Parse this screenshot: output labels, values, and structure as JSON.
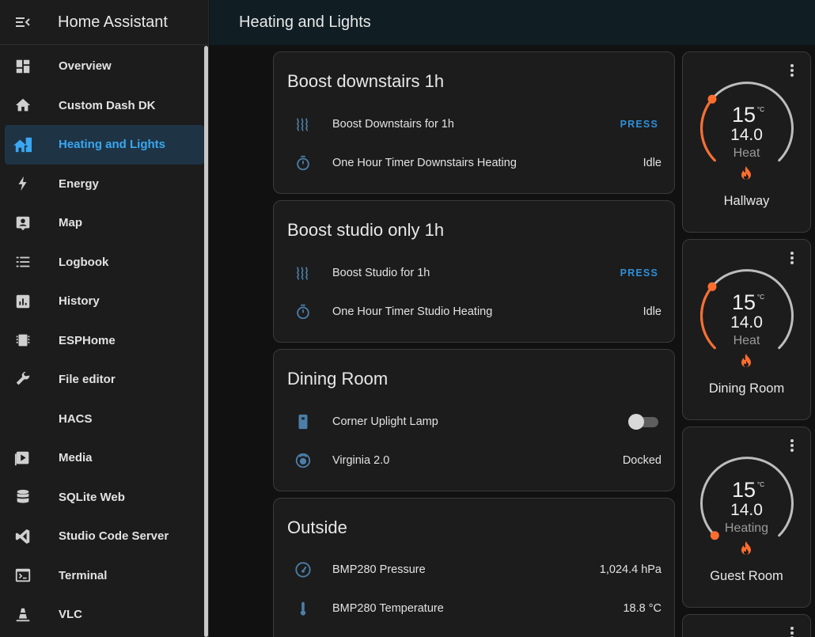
{
  "app": {
    "title": "Home Assistant"
  },
  "page": {
    "title": "Heating and Lights"
  },
  "sidebar": {
    "items": [
      {
        "label": "Overview",
        "icon": "dashboard-icon"
      },
      {
        "label": "Custom Dash DK",
        "icon": "home-icon"
      },
      {
        "label": "Heating and Lights",
        "icon": "home-city-icon"
      },
      {
        "label": "Energy",
        "icon": "lightning-icon"
      },
      {
        "label": "Map",
        "icon": "map-account-icon"
      },
      {
        "label": "Logbook",
        "icon": "list-icon"
      },
      {
        "label": "History",
        "icon": "chart-box-icon"
      },
      {
        "label": "ESPHome",
        "icon": "chip-icon"
      },
      {
        "label": "File editor",
        "icon": "wrench-icon"
      },
      {
        "label": "HACS",
        "icon": ""
      },
      {
        "label": "Media",
        "icon": "play-box-icon"
      },
      {
        "label": "SQLite Web",
        "icon": "database-icon"
      },
      {
        "label": "Studio Code Server",
        "icon": "vscode-icon"
      },
      {
        "label": "Terminal",
        "icon": "console-icon"
      },
      {
        "label": "VLC",
        "icon": "cone-icon"
      }
    ],
    "active_index": 2
  },
  "cards": [
    {
      "title": "Boost downstairs 1h",
      "rows": [
        {
          "name": "Boost Downstairs for 1h",
          "action": "PRESS",
          "icon": "heat-wave-icon"
        },
        {
          "name": "One Hour Timer Downstairs Heating",
          "state": "Idle",
          "icon": "timer-icon"
        }
      ]
    },
    {
      "title": "Boost studio only 1h",
      "rows": [
        {
          "name": "Boost Studio for 1h",
          "action": "PRESS",
          "icon": "heat-wave-icon"
        },
        {
          "name": "One Hour Timer Studio Heating",
          "state": "Idle",
          "icon": "timer-icon"
        }
      ]
    },
    {
      "title": "Dining Room",
      "rows": [
        {
          "name": "Corner Uplight Lamp",
          "toggle_on": false,
          "icon": "light-switch-icon"
        },
        {
          "name": "Virginia 2.0",
          "state": "Docked",
          "icon": "robot-vacuum-icon"
        }
      ]
    },
    {
      "title": "Outside",
      "rows": [
        {
          "name": "BMP280 Pressure",
          "state": "1,024.4 hPa",
          "icon": "gauge-icon"
        },
        {
          "name": "BMP280 Temperature",
          "state": "18.8 °C",
          "icon": "thermometer-icon"
        }
      ]
    }
  ],
  "thermostats": [
    {
      "name": "Hallway",
      "target": "15",
      "unit": "°C",
      "current": "14.0",
      "mode": "Heat",
      "target_fraction": 0.2,
      "accent": "#ff6d2e"
    },
    {
      "name": "Dining Room",
      "target": "15",
      "unit": "°C",
      "current": "14.0",
      "mode": "Heat",
      "target_fraction": 0.2,
      "accent": "#ff6d2e"
    },
    {
      "name": "Guest Room",
      "target": "15",
      "unit": "°C",
      "current": "14.0",
      "mode": "Heating",
      "target_fraction": 0.0,
      "accent": "#ff6d2e"
    }
  ],
  "colors": {
    "accent_blue": "#2f8fd8",
    "active_item": "#3aa7f2",
    "flame": "#ff6d2e",
    "icon_blue": "#4b7ea8"
  }
}
